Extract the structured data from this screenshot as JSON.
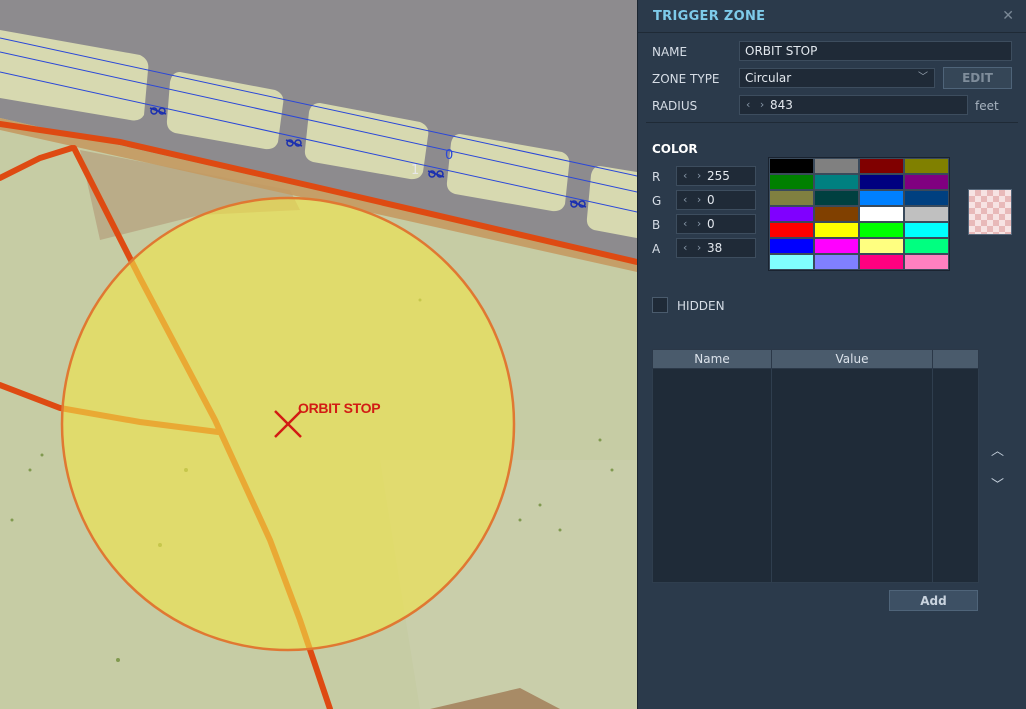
{
  "map": {
    "zone_label": "ORBIT STOP",
    "numbers": [
      "1",
      "0"
    ]
  },
  "panel": {
    "title": "TRIGGER ZONE",
    "name_label": "NAME",
    "name_value": "ORBIT STOP",
    "zone_type_label": "ZONE TYPE",
    "zone_type_value": "Circular",
    "edit_label": "EDIT",
    "radius_label": "RADIUS",
    "radius_value": "843",
    "radius_unit": "feet",
    "color_heading": "COLOR",
    "r_label": "R",
    "r_value": "255",
    "g_label": "G",
    "g_value": "0",
    "b_label": "B",
    "b_value": "0",
    "a_label": "A",
    "a_value": "38",
    "hidden_label": "HIDDEN",
    "table_headers": [
      "Name",
      "Value"
    ],
    "add_label": "Add"
  },
  "colors": {
    "accent_title": "#7ecbea",
    "preview_color": "#ff0000",
    "swatches": [
      "#000000",
      "#808080",
      "#800000",
      "#808000",
      "#008000",
      "#008080",
      "#000080",
      "#800080",
      "#808040",
      "#004040",
      "#0080ff",
      "#004080",
      "#8000ff",
      "#804000",
      "#ffffff",
      "#c0c0c0",
      "#ff0000",
      "#ffff00",
      "#00ff00",
      "#00ffff",
      "#0000ff",
      "#ff00ff",
      "#ffff80",
      "#00ff80",
      "#80ffff",
      "#8080ff",
      "#ff0080",
      "#ff80c0"
    ]
  },
  "icons": {
    "close": "close-icon",
    "spinner": "spinner-arrows-icon",
    "dropdown": "chevron-down-icon",
    "up": "move-up-icon",
    "down": "move-down-icon"
  }
}
